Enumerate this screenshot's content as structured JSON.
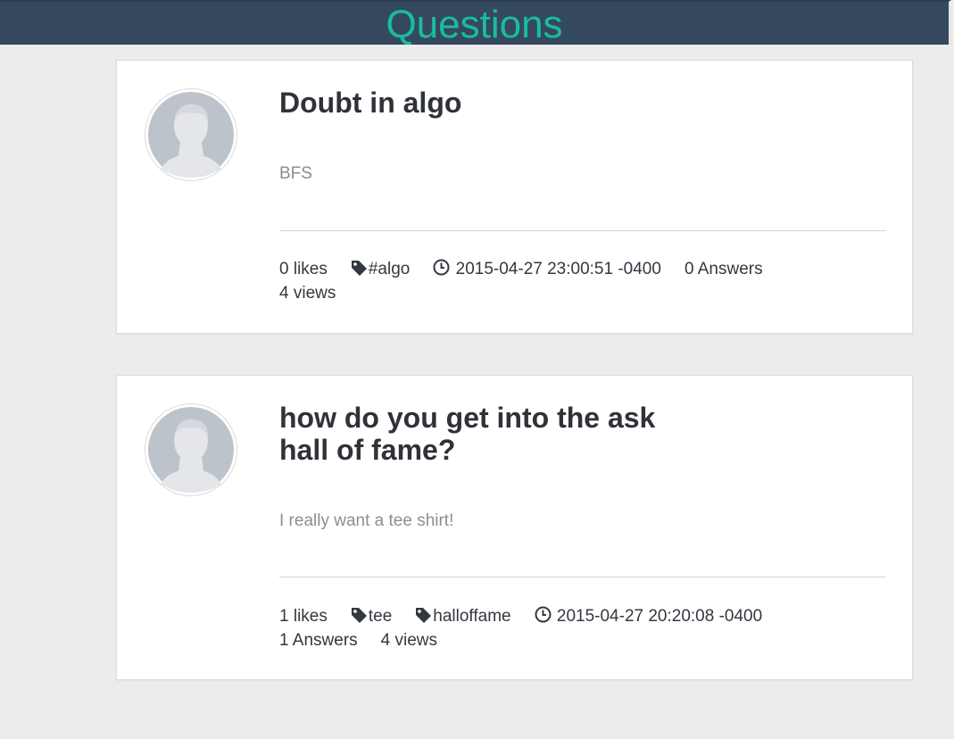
{
  "header": {
    "title": "Questions"
  },
  "colors": {
    "header_bg": "#34495e",
    "header_title": "#1abc9c",
    "page_bg": "#ececec",
    "card_bg": "#ffffff",
    "title_text": "#2f3238",
    "body_text": "#8a8f94"
  },
  "questions": [
    {
      "avatar_icon": "default-user-avatar-icon",
      "title": "Doubt in algo",
      "body": "BFS",
      "likes": "0 likes",
      "tags": [
        "#algo"
      ],
      "timestamp": "2015-04-27 23:00:51 -0400",
      "answers": "0 Answers",
      "views": "4 views"
    },
    {
      "avatar_icon": "default-user-avatar-icon",
      "title": "how do you get into the ask hall of fame?",
      "body": "I really want a tee shirt!",
      "likes": "1 likes",
      "tags": [
        "tee",
        "halloffame"
      ],
      "timestamp": "2015-04-27 20:20:08 -0400",
      "answers": "1 Answers",
      "views": "4 views"
    }
  ]
}
